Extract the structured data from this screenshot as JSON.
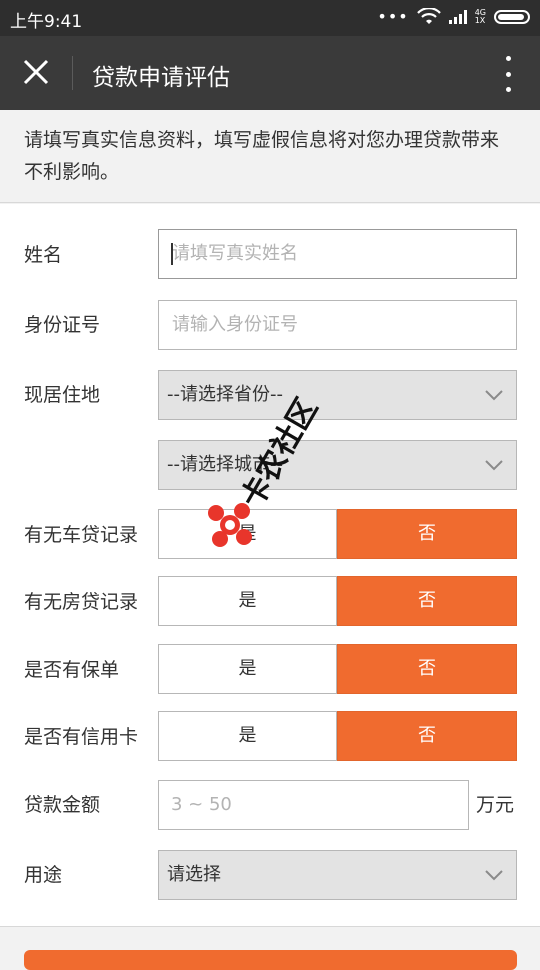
{
  "status_bar": {
    "time": "上午9:41",
    "net_type_top": "4G",
    "net_type_bottom": "1X"
  },
  "app_bar": {
    "title": "贷款申请评估",
    "close_icon": "close-icon",
    "more_icon": "more-vertical-icon"
  },
  "notice": "请填写真实信息资料，填写虚假信息将对您办理贷款带来不利影响。",
  "form": {
    "name": {
      "label": "姓名",
      "placeholder": "请填写真实姓名"
    },
    "id_number": {
      "label": "身份证号",
      "placeholder": "请输入身份证号"
    },
    "residence": {
      "label": "现居住地",
      "province_select": "--请选择省份--",
      "city_select": "--请选择城市--"
    },
    "car_loan": {
      "label": "有无车贷记录",
      "yes": "是",
      "no": "否"
    },
    "house_loan": {
      "label": "有无房贷记录",
      "yes": "是",
      "no": "否"
    },
    "insurance": {
      "label": "是否有保单",
      "yes": "是",
      "no": "否"
    },
    "credit_card": {
      "label": "是否有信用卡",
      "yes": "是",
      "no": "否"
    },
    "amount": {
      "label": "贷款金额",
      "placeholder": "3 ~ 50",
      "unit": "万元"
    },
    "purpose": {
      "label": "用途",
      "select": "请选择"
    }
  },
  "watermark": {
    "text": "卡农社区"
  },
  "colors": {
    "accent": "#f06b2f",
    "app_bar": "#3a3a3a",
    "status_bar": "#2e2e2e"
  }
}
